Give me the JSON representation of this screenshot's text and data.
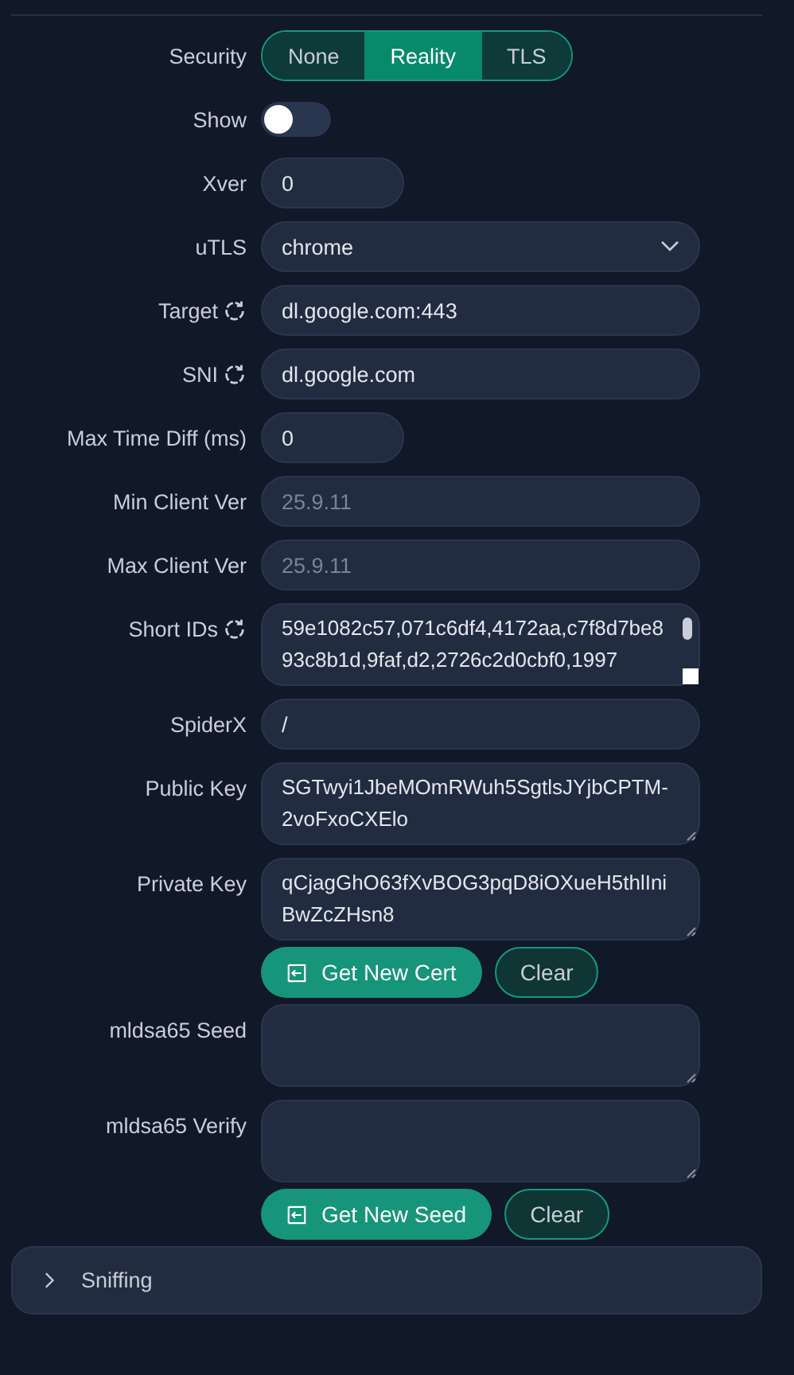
{
  "fields": [
    {
      "kind": "segmented",
      "label": "Security",
      "options": [
        {
          "label": "None",
          "selected": false
        },
        {
          "label": "Reality",
          "selected": true
        },
        {
          "label": "TLS",
          "selected": false
        }
      ]
    },
    {
      "kind": "switch",
      "label": "Show",
      "on": false
    },
    {
      "kind": "number",
      "label": "Xver",
      "value": "0"
    },
    {
      "kind": "select",
      "label": "uTLS",
      "value": "chrome"
    },
    {
      "kind": "input",
      "label": "Target",
      "refresh": true,
      "value": "dl.google.com:443"
    },
    {
      "kind": "input",
      "label": "SNI",
      "refresh": true,
      "value": "dl.google.com"
    },
    {
      "kind": "number",
      "label": "Max Time Diff (ms)",
      "value": "0"
    },
    {
      "kind": "input",
      "label": "Min Client Ver",
      "placeholder": "25.9.11"
    },
    {
      "kind": "input",
      "label": "Max Client Ver",
      "placeholder": "25.9.11"
    },
    {
      "kind": "textarea",
      "label": "Short IDs",
      "refresh": true,
      "scroll": true,
      "value": "59e1082c57,071c6df4,4172aa,c7f8d7be893c8b1d,9faf,d2,2726c2d0cbf0,1997"
    },
    {
      "kind": "input",
      "label": "SpiderX",
      "value": "/"
    },
    {
      "kind": "textarea",
      "label": "Public Key",
      "value": "SGTwyi1JbeMOmRWuh5SgtlsJYjbCPTM-2voFxoCXElo"
    },
    {
      "kind": "textarea",
      "label": "Private Key",
      "value": "qCjagGhO63fXvBOG3pqD8iOXueH5thlIniBwZcZHsn8"
    },
    {
      "kind": "buttons",
      "primary": "Get New Cert",
      "secondary": "Clear"
    },
    {
      "kind": "textarea",
      "label": "mldsa65 Seed"
    },
    {
      "kind": "textarea",
      "label": "mldsa65 Verify"
    },
    {
      "kind": "buttons",
      "primary": "Get New Seed",
      "secondary": "Clear"
    }
  ],
  "sniffing": {
    "title": "Sniffing",
    "expanded": false
  }
}
